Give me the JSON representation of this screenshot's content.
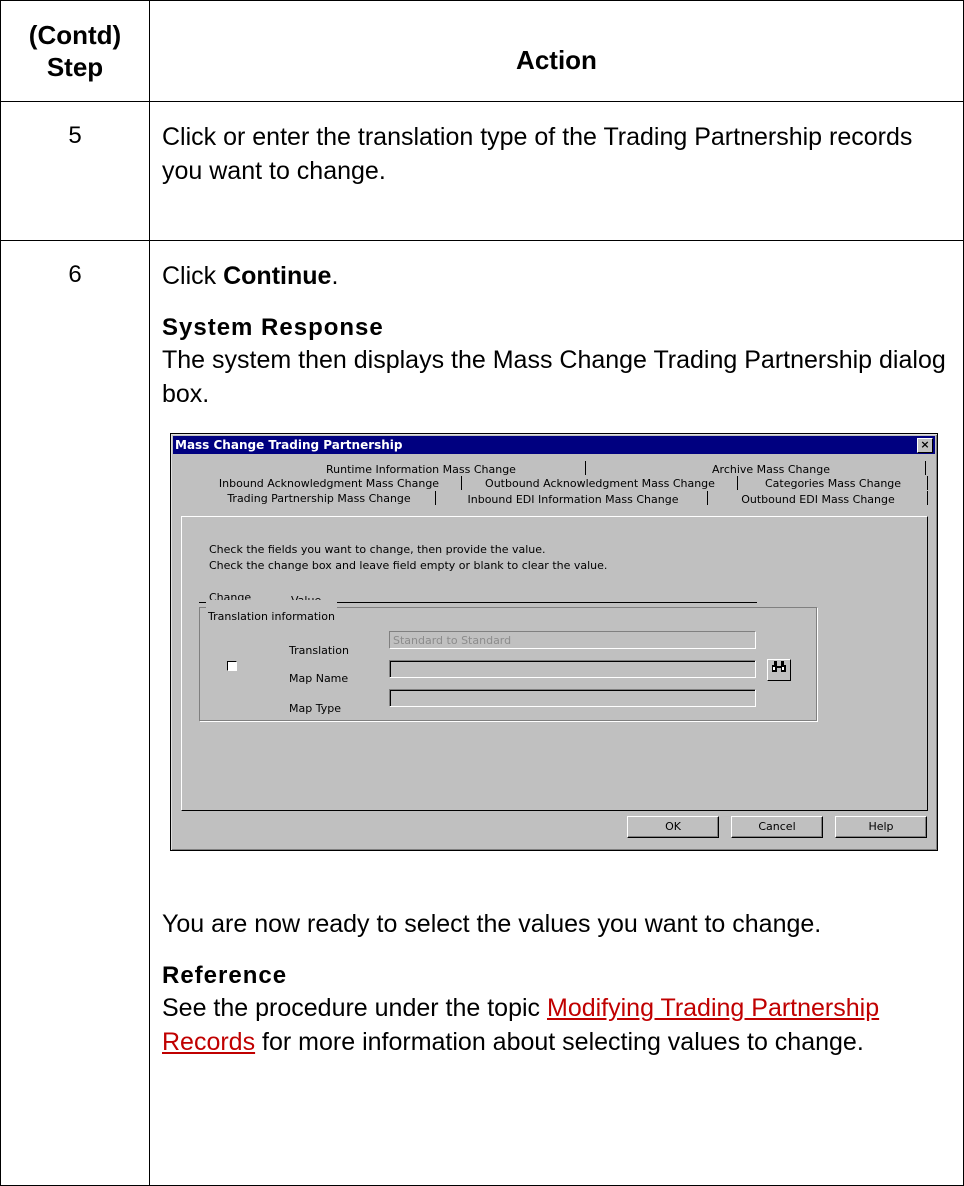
{
  "header": {
    "step_label": "(Contd)\nStep",
    "step_line1": "(Contd)",
    "step_line2": "Step",
    "action_label": "Action"
  },
  "steps": [
    {
      "number": "5",
      "text": "Click or enter the translation type of the Trading Partnership records you want to change."
    },
    {
      "number": "6",
      "text_pre": "Click ",
      "text_bold": "Continue",
      "text_post": ".",
      "system_response_heading": "System Response",
      "system_response_text": "The system then displays the Mass Change Trading Partnership dialog box.",
      "after_dialog_text": "You are now ready to select the values you want to change.",
      "reference_heading": "Reference",
      "reference_pre": "See the procedure under the topic ",
      "reference_link": "Modifying Trading Partnership Records",
      "reference_post": " for more information about selecting values to change."
    }
  ],
  "dialog": {
    "title": "Mass Change Trading Partnership",
    "close_glyph": "×",
    "tabs_row1": [
      "Runtime Information Mass Change",
      "Archive Mass Change"
    ],
    "tabs_row2": [
      "Inbound Acknowledgment Mass Change",
      "Outbound Acknowledgment Mass Change",
      "Categories Mass Change"
    ],
    "tabs_row3": [
      "Trading Partnership Mass Change",
      "Inbound EDI Information Mass Change",
      "Outbound EDI Mass Change"
    ],
    "instruction1": "Check the fields you want to change, then provide the value.",
    "instruction2": "Check the change box and leave field empty or blank to clear the value.",
    "col_change": "Change",
    "col_value": "Value",
    "group_title": "Translation information",
    "translation_label": "Translation",
    "translation_value": "Standard to Standard",
    "map_name_label": "Map Name",
    "map_name_value": "",
    "map_type_label": "Map Type",
    "map_type_value": "",
    "find_icon": "binoculars-icon",
    "buttons": {
      "ok": "OK",
      "cancel": "Cancel",
      "help": "Help"
    }
  }
}
